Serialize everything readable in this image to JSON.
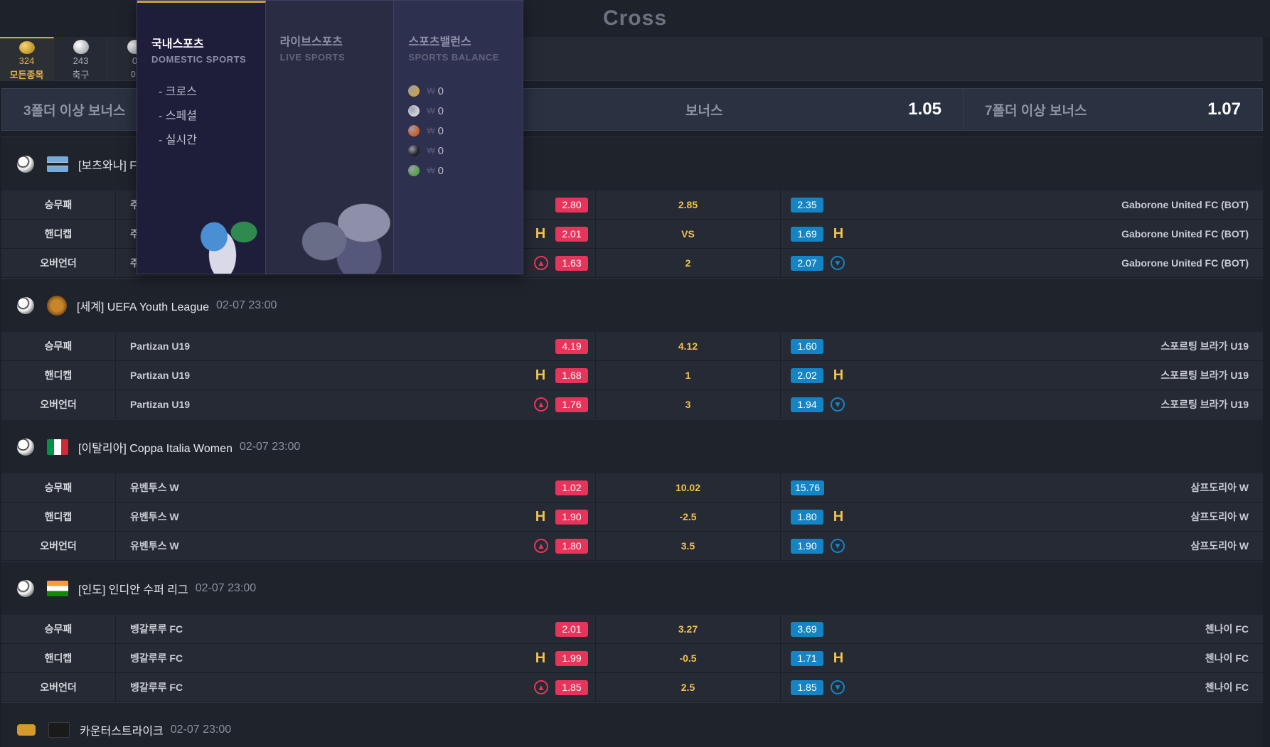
{
  "page": {
    "title": "Cross"
  },
  "sport_tabs": [
    {
      "count": "324",
      "name": "모든종목",
      "active": true
    },
    {
      "count": "243",
      "name": "축구",
      "active": false
    },
    {
      "count": "0",
      "name": "야",
      "active": false
    }
  ],
  "bonus": [
    {
      "label": "3폴더 이상 보너스",
      "value": ""
    },
    {
      "label": "보너스",
      "value": "1.05"
    },
    {
      "label": "7폴더 이상 보너스",
      "value": "1.07"
    }
  ],
  "mega_menu": {
    "domestic": {
      "title": "국내스포츠",
      "sub": "DOMESTIC SPORTS",
      "links": [
        "- 크로스",
        "- 스페셜",
        "- 실시간"
      ]
    },
    "live": {
      "title": "라이브스포츠",
      "sub": "LIVE SPORTS"
    },
    "balance": {
      "title": "스포츠밸런스",
      "sub": "SPORTS BALANCE",
      "currency": "₩",
      "items": [
        {
          "icon": "soccer-ball-icon",
          "color": "#c8a24a",
          "value": "0"
        },
        {
          "icon": "baseball-icon",
          "color": "#cfcfd8",
          "value": "0"
        },
        {
          "icon": "basketball-icon",
          "color": "#d0602a",
          "value": "0"
        },
        {
          "icon": "hockey-puck-icon",
          "color": "#222428",
          "value": "0"
        },
        {
          "icon": "tennis-icon",
          "color": "#5aa34a",
          "value": "0"
        }
      ]
    }
  },
  "leagues": [
    {
      "name": "[보츠와나] F",
      "time": "",
      "flag": "botswana",
      "rows": [
        {
          "type": "승무패",
          "home": "주",
          "mark": "",
          "odd_home": "2.80",
          "mid": "2.85",
          "odd_away": "2.35",
          "mark_r": "",
          "away": "Gaborone United FC (BOT)"
        },
        {
          "type": "핸디캡",
          "home": "주",
          "mark": "H",
          "odd_home": "2.01",
          "mid": "VS",
          "odd_away": "1.69",
          "mark_r": "H",
          "away": "Gaborone United FC (BOT)"
        },
        {
          "type": "오버언더",
          "home": "주",
          "mark": "▲",
          "odd_home": "1.63",
          "mid": "2",
          "odd_away": "2.07",
          "mark_r": "▼",
          "away": "Gaborone United FC (BOT)"
        }
      ]
    },
    {
      "name": "[세계] UEFA Youth League",
      "time": "02-07 23:00",
      "flag": "world",
      "rows": [
        {
          "type": "승무패",
          "home": "Partizan U19",
          "mark": "",
          "odd_home": "4.19",
          "mid": "4.12",
          "odd_away": "1.60",
          "mark_r": "",
          "away": "스포르팅 브라가 U19"
        },
        {
          "type": "핸디캡",
          "home": "Partizan U19",
          "mark": "H",
          "odd_home": "1.68",
          "mid": "1",
          "odd_away": "2.02",
          "mark_r": "H",
          "away": "스포르팅 브라가 U19"
        },
        {
          "type": "오버언더",
          "home": "Partizan U19",
          "mark": "▲",
          "odd_home": "1.76",
          "mid": "3",
          "odd_away": "1.94",
          "mark_r": "▼",
          "away": "스포르팅 브라가 U19"
        }
      ]
    },
    {
      "name": "[이탈리아] Coppa Italia Women",
      "time": "02-07 23:00",
      "flag": "italy",
      "rows": [
        {
          "type": "승무패",
          "home": "유벤투스 W",
          "mark": "",
          "odd_home": "1.02",
          "mid": "10.02",
          "odd_away": "15.76",
          "mark_r": "",
          "away": "삼프도리아 W"
        },
        {
          "type": "핸디캡",
          "home": "유벤투스 W",
          "mark": "H",
          "odd_home": "1.90",
          "mid": "-2.5",
          "odd_away": "1.80",
          "mark_r": "H",
          "away": "삼프도리아 W"
        },
        {
          "type": "오버언더",
          "home": "유벤투스 W",
          "mark": "▲",
          "odd_home": "1.80",
          "mid": "3.5",
          "odd_away": "1.90",
          "mark_r": "▼",
          "away": "삼프도리아 W"
        }
      ]
    },
    {
      "name": "[인도] 인디안 수퍼 리그",
      "time": "02-07 23:00",
      "flag": "india",
      "rows": [
        {
          "type": "승무패",
          "home": "벵갈루루 FC",
          "mark": "",
          "odd_home": "2.01",
          "mid": "3.27",
          "odd_away": "3.69",
          "mark_r": "",
          "away": "첸나이 FC"
        },
        {
          "type": "핸디캡",
          "home": "벵갈루루 FC",
          "mark": "H",
          "odd_home": "1.99",
          "mid": "-0.5",
          "odd_away": "1.71",
          "mark_r": "H",
          "away": "첸나이 FC"
        },
        {
          "type": "오버언더",
          "home": "벵갈루루 FC",
          "mark": "▲",
          "odd_home": "1.85",
          "mid": "2.5",
          "odd_away": "1.85",
          "mark_r": "▼",
          "away": "첸나이 FC"
        }
      ]
    },
    {
      "name": "카운터스트라이크",
      "time": "02-07 23:00",
      "flag": "cs",
      "rows": []
    }
  ]
}
